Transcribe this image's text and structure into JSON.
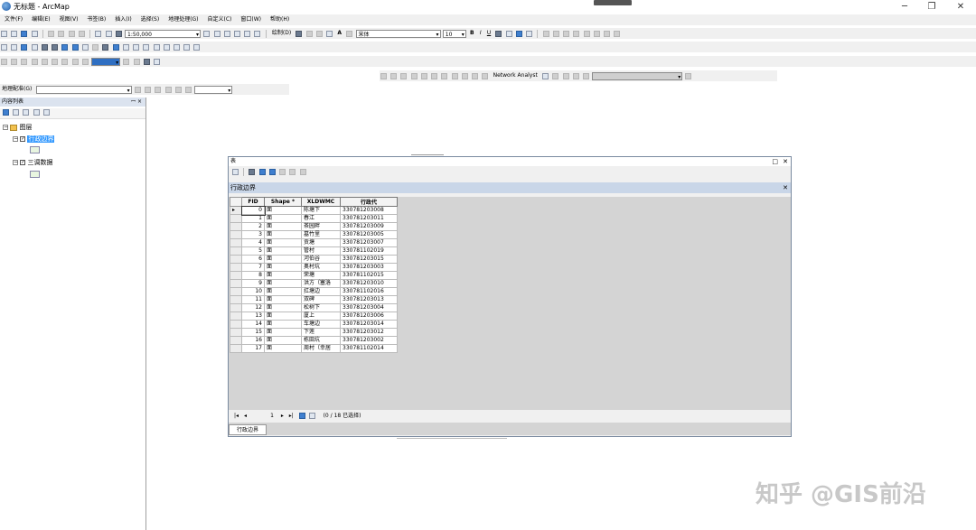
{
  "window": {
    "title": "无标题 - ArcMap",
    "minimize": "─",
    "maximize": "❐",
    "close": "✕"
  },
  "menu": [
    "文件(F)",
    "编辑(E)",
    "视图(V)",
    "书签(B)",
    "插入(I)",
    "选择(S)",
    "地理处理(G)",
    "自定义(C)",
    "窗口(W)",
    "帮助(H)"
  ],
  "toolbar": {
    "scale": "1:50,000",
    "draw_label": "绘制(D)",
    "text_tool": "A",
    "font_name": "宋体",
    "font_size": "10",
    "bold": "B",
    "italic": "I",
    "underline": "U",
    "network_analyst": "Network Analyst",
    "georef_label": "地理配准(G)"
  },
  "toc": {
    "title": "内容列表",
    "pin": "ꟷ ×",
    "root": "图层",
    "layers": [
      {
        "name": "行政边界",
        "checked": true,
        "selected": true
      },
      {
        "name": "三调数据",
        "checked": true,
        "selected": false
      }
    ]
  },
  "table_window": {
    "title": "表",
    "layer_tab": "行政边界",
    "columns": [
      "FID",
      "Shape *",
      "XLDWMC",
      "行政代"
    ],
    "rows": [
      [
        "0",
        "面",
        "陈塘下",
        "330781203008"
      ],
      [
        "1",
        "面",
        "春江",
        "330781203011"
      ],
      [
        "2",
        "面",
        "茶园畔",
        "330781203009"
      ],
      [
        "3",
        "面",
        "墓竹里",
        "330781203005"
      ],
      [
        "4",
        "面",
        "贡塘",
        "330781203007"
      ],
      [
        "5",
        "面",
        "管村",
        "330781102019"
      ],
      [
        "6",
        "面",
        "河伯谷",
        "330781203015"
      ],
      [
        "7",
        "面",
        "奥村坑",
        "330781203003"
      ],
      [
        "8",
        "面",
        "荣塘",
        "330781102015"
      ],
      [
        "9",
        "面",
        "洪方（塞洛",
        "330781203010"
      ],
      [
        "10",
        "面",
        "扛塘边",
        "330781102016"
      ],
      [
        "11",
        "面",
        "双碑",
        "330781203013"
      ],
      [
        "12",
        "面",
        "松树下",
        "330781203004"
      ],
      [
        "13",
        "面",
        "厦上",
        "330781203006"
      ],
      [
        "14",
        "面",
        "车塘边",
        "330781203014"
      ],
      [
        "15",
        "面",
        "下莲",
        "330781203012"
      ],
      [
        "16",
        "面",
        "栋田坑",
        "330781203002"
      ],
      [
        "17",
        "面",
        "周村（幸居",
        "330781102014"
      ]
    ],
    "record_index": "1",
    "selection_status": "(0 / 18 已选择)",
    "bottom_tab": "行政边界"
  },
  "watermark": "知乎 @GIS前沿",
  "colors": {
    "toc_header": "#dbe3ef",
    "layer_selected": "#3399ff",
    "table_tab": "#c9d6e8"
  }
}
